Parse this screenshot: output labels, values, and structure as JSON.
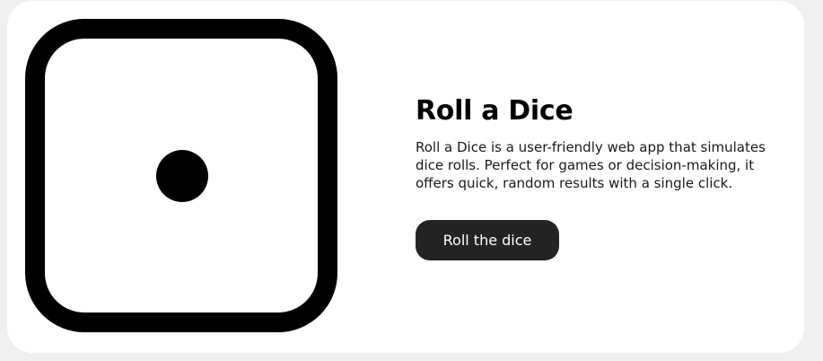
{
  "app": {
    "title": "Roll a Dice",
    "description": "Roll a Dice is a user-friendly web app that simulates dice rolls. Perfect for games or decision-making, it offers quick, random results with a single click.",
    "button_label": "Roll the dice"
  },
  "dice": {
    "face_value": 1,
    "icon": "dice-one-icon",
    "color": "#000000",
    "background": "#ffffff"
  },
  "theme": {
    "card_background": "#ffffff",
    "page_background": "#efefef",
    "button_background": "#232323",
    "button_text": "#ffffff"
  }
}
